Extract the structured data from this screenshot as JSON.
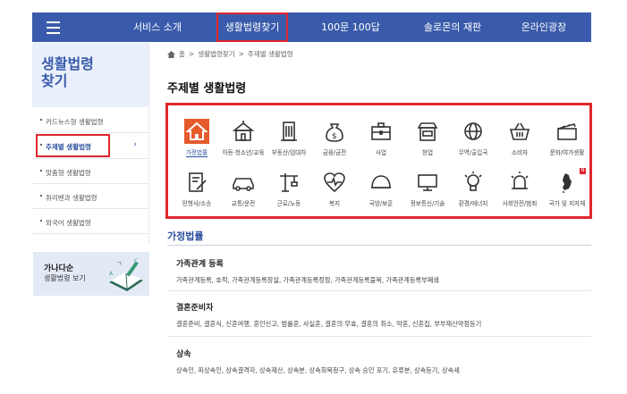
{
  "nav": {
    "items": [
      {
        "label": "서비스 소개"
      },
      {
        "label": "생활법령찾기"
      },
      {
        "label": "100문 100답"
      },
      {
        "label": "솔로몬의 재판"
      },
      {
        "label": "온라인광장"
      }
    ]
  },
  "sidebar": {
    "title_line1": "생활법령",
    "title_line2": "찾기",
    "items": [
      {
        "label": "카드뉴스형 생활법령"
      },
      {
        "label": "주제별 생활법령",
        "arrow": "›"
      },
      {
        "label": "맞춤형 생활법령"
      },
      {
        "label": "취리벤과 생활법령"
      },
      {
        "label": "외국어 생활법령"
      }
    ]
  },
  "dict_banner": {
    "line1": "가나다순",
    "line2": "생활법령 보기"
  },
  "breadcrumb": {
    "items": [
      "홈",
      "생활법령찾기",
      "주제별 생활법령"
    ],
    "separator": ">"
  },
  "page_title": "주제별 생활법령",
  "topics": [
    {
      "label": "가정법률",
      "icon": "home-icon"
    },
    {
      "label": "아동·청소년/교육",
      "icon": "school-icon"
    },
    {
      "label": "부동산/임대차",
      "icon": "building-icon"
    },
    {
      "label": "금융/금전",
      "icon": "money-bag-icon"
    },
    {
      "label": "사업",
      "icon": "briefcase-icon"
    },
    {
      "label": "창업",
      "icon": "store-icon"
    },
    {
      "label": "무역/출입국",
      "icon": "globe-icon"
    },
    {
      "label": "소비자",
      "icon": "basket-icon"
    },
    {
      "label": "문화/여가생활",
      "icon": "clapperboard-icon"
    },
    {
      "label": "민형사/소송",
      "icon": "document-pen-icon"
    },
    {
      "label": "교통/운전",
      "icon": "car-icon"
    },
    {
      "label": "근로/노동",
      "icon": "crane-icon"
    },
    {
      "label": "복지",
      "icon": "heart-pulse-icon"
    },
    {
      "label": "국방/보훈",
      "icon": "helmet-icon"
    },
    {
      "label": "정보통신/기술",
      "icon": "monitor-icon"
    },
    {
      "label": "환경/에너지",
      "icon": "lightbulb-icon"
    },
    {
      "label": "사회안전/범죄",
      "icon": "siren-icon"
    },
    {
      "label": "국가 및 지자체",
      "icon": "korea-map-icon",
      "badge": "N"
    }
  ],
  "category": {
    "title": "가정법률",
    "entries": [
      {
        "title": "가족관계 등록",
        "desc": "가족관계등록, 호적, 가족관계등록창설, 가족관계등록정정, 가족관계등록불복, 가족관계등록부폐쇄"
      },
      {
        "title": "결혼준비자",
        "desc": "결혼준비, 결혼식, 신혼여행, 혼인신고, 범률혼, 사실혼, 결혼의 무효, 결혼의 취소, 약혼, 신혼집, 부부재산약정등기"
      },
      {
        "title": "상속",
        "desc": "상속인, 피상속인, 상속결격자, 상속재산, 상속분, 상속회복청구, 상속 승인 포기, 유류분, 상속등기, 상속세"
      }
    ]
  },
  "colors": {
    "nav_bg": "#3a5bab",
    "accent": "#2b4fa0",
    "highlight": "#e0262e",
    "active_icon": "#e55a2b"
  }
}
